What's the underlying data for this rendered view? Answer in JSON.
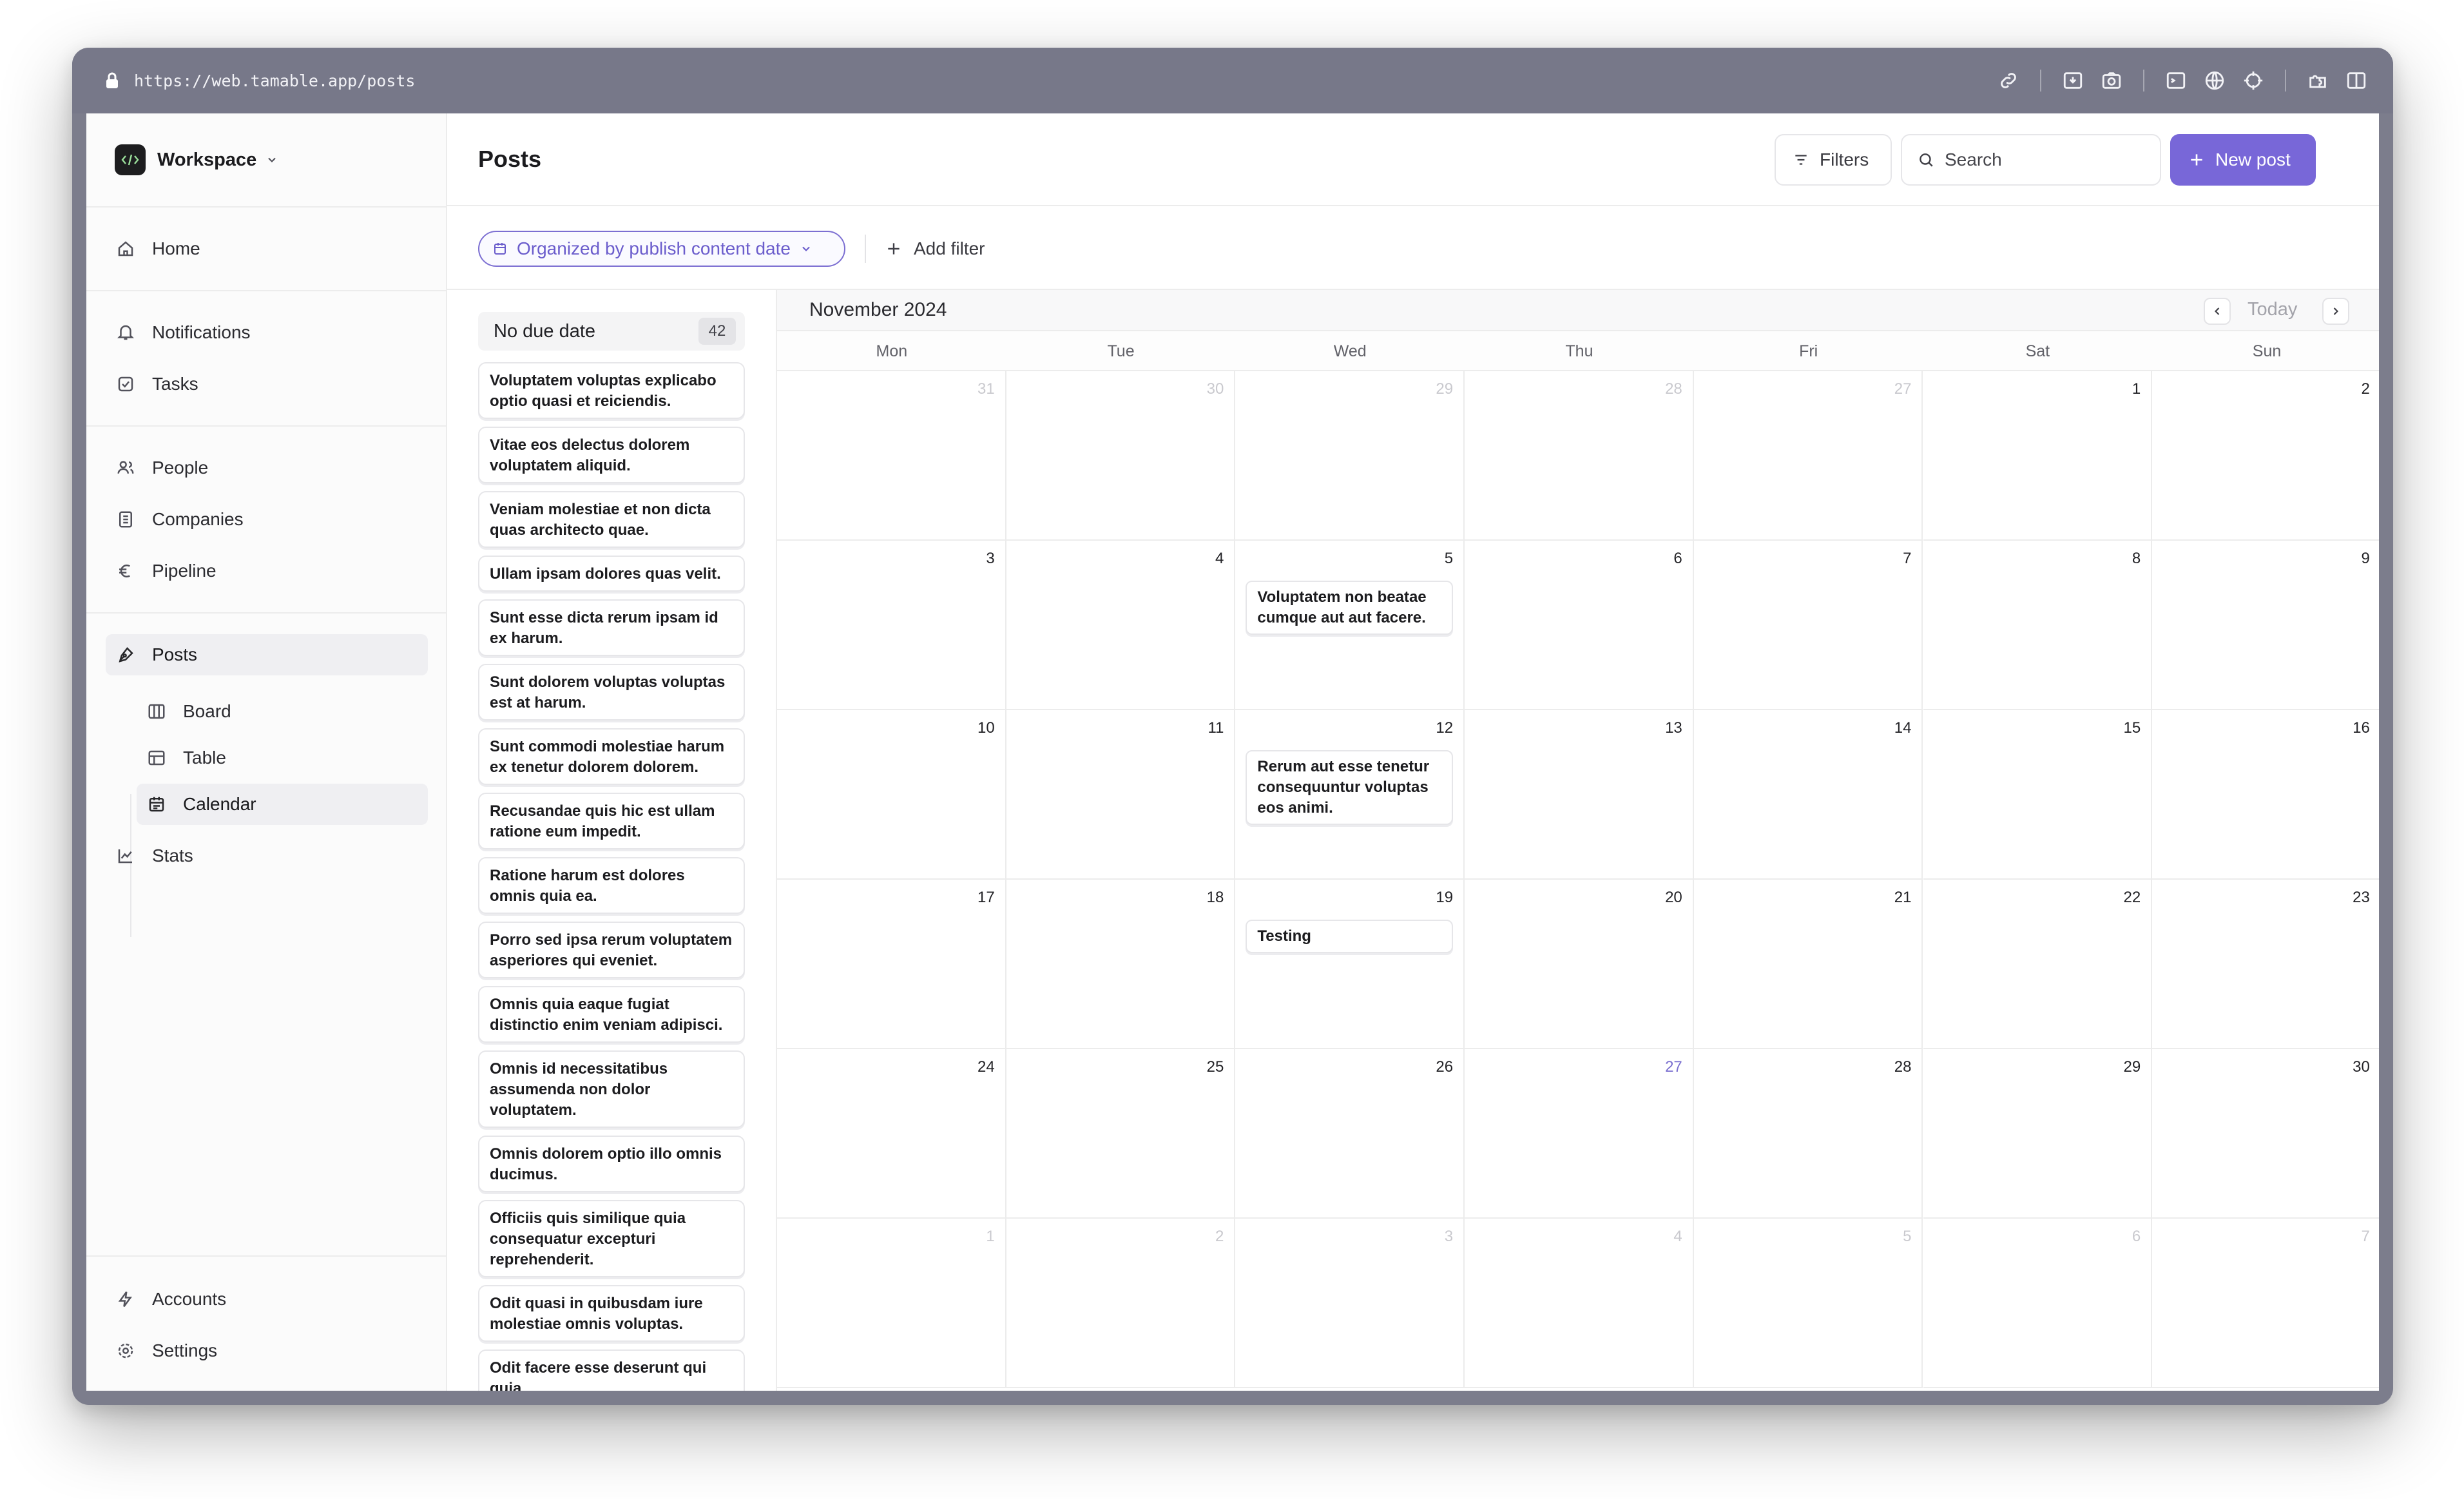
{
  "browser": {
    "url": "https://web.tamable.app/posts"
  },
  "sidebar": {
    "workspace": "Workspace",
    "nav": {
      "home": "Home",
      "notifications": "Notifications",
      "tasks": "Tasks",
      "people": "People",
      "companies": "Companies",
      "pipeline": "Pipeline",
      "posts": "Posts",
      "board": "Board",
      "table": "Table",
      "calendar": "Calendar",
      "stats": "Stats",
      "accounts": "Accounts",
      "settings": "Settings"
    }
  },
  "header": {
    "title": "Posts",
    "filters_label": "Filters",
    "search_placeholder": "Search",
    "new_post_label": "New post"
  },
  "filter_bar": {
    "organize_label": "Organized by publish content date",
    "add_filter_label": "Add filter"
  },
  "backlog": {
    "title": "No due date",
    "count": "42",
    "items": [
      "Voluptatem voluptas explicabo optio quasi et reiciendis.",
      "Vitae eos delectus dolorem voluptatem aliquid.",
      "Veniam molestiae et non dicta quas architecto quae.",
      "Ullam ipsam dolores quas velit.",
      "Sunt esse dicta rerum ipsam id ex harum.",
      "Sunt dolorem voluptas voluptas est at harum.",
      "Sunt commodi molestiae harum ex tenetur dolorem dolorem.",
      "Recusandae quis hic est ullam ratione eum impedit.",
      "Ratione harum est dolores omnis quia ea.",
      "Porro sed ipsa rerum voluptatem asperiores qui eveniet.",
      "Omnis quia eaque fugiat distinctio enim veniam adipisci.",
      "Omnis id necessitatibus assumenda non dolor voluptatem.",
      "Omnis dolorem optio illo omnis ducimus.",
      "Officiis quis similique quia consequatur excepturi reprehenderit.",
      "Odit quasi in quibusdam iure molestiae omnis voluptas.",
      "Odit facere esse deserunt qui quia."
    ]
  },
  "calendar": {
    "month_label": "November 2024",
    "today_label": "Today",
    "weekdays": [
      "Mon",
      "Tue",
      "Wed",
      "Thu",
      "Fri",
      "Sat",
      "Sun"
    ],
    "weeks": [
      [
        {
          "d": "31",
          "dim": true
        },
        {
          "d": "30",
          "dim": true
        },
        {
          "d": "29",
          "dim": true
        },
        {
          "d": "28",
          "dim": true
        },
        {
          "d": "27",
          "dim": true
        },
        {
          "d": "1"
        },
        {
          "d": "2"
        }
      ],
      [
        {
          "d": "3"
        },
        {
          "d": "4"
        },
        {
          "d": "5",
          "event": "Voluptatem non beatae cumque aut aut facere."
        },
        {
          "d": "6"
        },
        {
          "d": "7"
        },
        {
          "d": "8"
        },
        {
          "d": "9"
        }
      ],
      [
        {
          "d": "10"
        },
        {
          "d": "11"
        },
        {
          "d": "12",
          "event": "Rerum aut esse tenetur consequuntur voluptas eos animi."
        },
        {
          "d": "13"
        },
        {
          "d": "14"
        },
        {
          "d": "15"
        },
        {
          "d": "16"
        }
      ],
      [
        {
          "d": "17"
        },
        {
          "d": "18"
        },
        {
          "d": "19",
          "event": "Testing"
        },
        {
          "d": "20"
        },
        {
          "d": "21"
        },
        {
          "d": "22"
        },
        {
          "d": "23"
        }
      ],
      [
        {
          "d": "24"
        },
        {
          "d": "25"
        },
        {
          "d": "26"
        },
        {
          "d": "27",
          "today": true
        },
        {
          "d": "28"
        },
        {
          "d": "29"
        },
        {
          "d": "30"
        }
      ],
      [
        {
          "d": "1",
          "dim": true
        },
        {
          "d": "2",
          "dim": true
        },
        {
          "d": "3",
          "dim": true
        },
        {
          "d": "4",
          "dim": true
        },
        {
          "d": "5",
          "dim": true
        },
        {
          "d": "6",
          "dim": true
        },
        {
          "d": "7",
          "dim": true
        }
      ]
    ]
  },
  "colors": {
    "accent": "#7867d8",
    "today": "#7a6fd0"
  }
}
